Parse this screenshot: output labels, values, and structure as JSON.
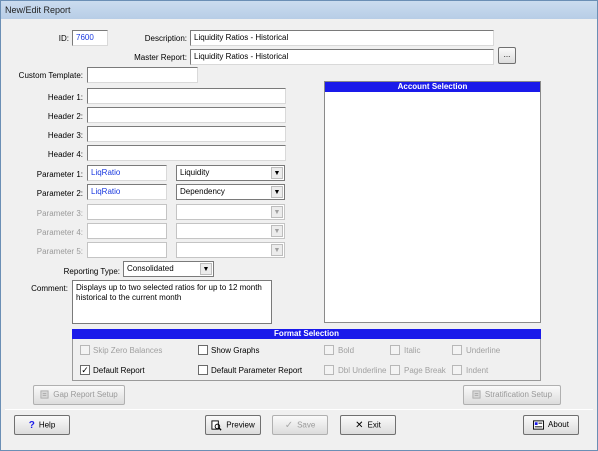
{
  "window": {
    "title": "New/Edit Report"
  },
  "form": {
    "id_label": "ID:",
    "id_value": "7600",
    "description_label": "Description:",
    "description_value": "Liquidity Ratios - Historical",
    "master_report_label": "Master Report:",
    "master_report_value": "Liquidity Ratios - Historical",
    "browse_label": "...",
    "custom_template_label": "Custom Template:",
    "custom_template_value": "",
    "headers": [
      {
        "label": "Header 1:",
        "value": ""
      },
      {
        "label": "Header 2:",
        "value": ""
      },
      {
        "label": "Header 3:",
        "value": ""
      },
      {
        "label": "Header 4:",
        "value": ""
      }
    ],
    "parameters": [
      {
        "label": "Parameter 1:",
        "value": "LiqRatio",
        "select": "Liquidity"
      },
      {
        "label": "Parameter 2:",
        "value": "LiqRatio",
        "select": "Dependency"
      },
      {
        "label": "Parameter 3:",
        "value": "",
        "select": ""
      },
      {
        "label": "Parameter 4:",
        "value": "",
        "select": ""
      },
      {
        "label": "Parameter 5:",
        "value": "",
        "select": ""
      }
    ],
    "reporting_type_label": "Reporting Type:",
    "reporting_type_value": "Consolidated",
    "comment_label": "Comment:",
    "comment_value": "Displays up to two selected ratios for up to 12 month historical to the current month"
  },
  "account_selection": {
    "title": "Account Selection"
  },
  "format_selection": {
    "title": "Format Selection",
    "options": [
      {
        "label": "Skip Zero Balances",
        "checked": false,
        "enabled": false
      },
      {
        "label": "Show Graphs",
        "checked": false,
        "enabled": true
      },
      {
        "label": "Bold",
        "checked": false,
        "enabled": false
      },
      {
        "label": "Italic",
        "checked": false,
        "enabled": false
      },
      {
        "label": "Underline",
        "checked": false,
        "enabled": false
      },
      {
        "label": "Default Report",
        "checked": true,
        "enabled": true
      },
      {
        "label": "Default Parameter Report",
        "checked": false,
        "enabled": true
      },
      {
        "label": "Dbl Underline",
        "checked": false,
        "enabled": false
      },
      {
        "label": "Page Break",
        "checked": false,
        "enabled": false
      },
      {
        "label": "Indent",
        "checked": false,
        "enabled": false
      }
    ],
    "check_mark": "✓"
  },
  "buttons": {
    "gap_report": "Gap Report Setup",
    "stratification": "Stratification Setup",
    "help": "Help",
    "preview": "Preview",
    "save": "Save",
    "exit": "Exit",
    "about": "About"
  },
  "icons": {
    "help": "question-icon",
    "preview": "magnifier-document-icon",
    "save": "checkmark-icon",
    "exit": "x-icon",
    "about": "info-card-icon"
  },
  "colors": {
    "panel_header": "#1a1aea",
    "value_text": "#1b3ae0"
  }
}
